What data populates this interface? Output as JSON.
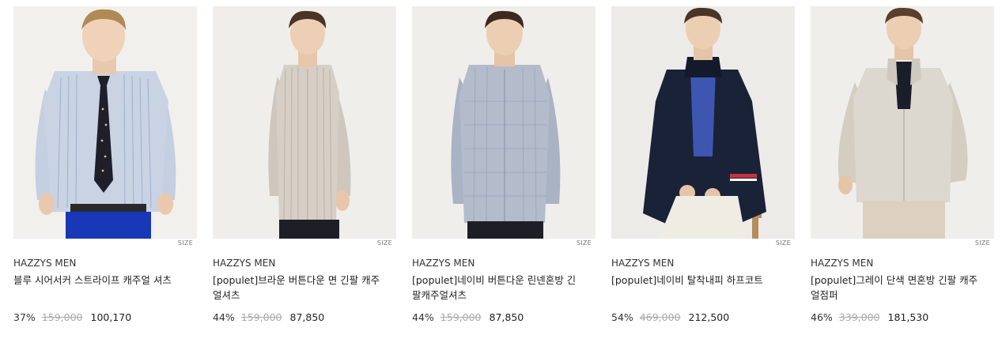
{
  "products": [
    {
      "brand": "HAZZYS MEN",
      "name": "블루 시어서커 스트라이프 캐주얼 셔츠",
      "discount": "37%",
      "original_price": "159,000",
      "sale_price": "100,170",
      "size_label": "SIZE",
      "garment_color": "#c9d3e4",
      "extra_color": "#1838b8"
    },
    {
      "brand": "HAZZYS MEN",
      "name": "[populet]브라운 버튼다운 면 긴팔 캐주얼셔츠",
      "discount": "44%",
      "original_price": "159,000",
      "sale_price": "87,850",
      "size_label": "SIZE",
      "garment_color": "#d6cfc6"
    },
    {
      "brand": "HAZZYS MEN",
      "name": "[populet]네이비 버튼다운 린넨혼방 긴팔캐주얼셔츠",
      "discount": "44%",
      "original_price": "159,000",
      "sale_price": "87,850",
      "size_label": "SIZE",
      "garment_color": "#b4bccb"
    },
    {
      "brand": "HAZZYS MEN",
      "name": "[populet]네이비 탈착내피 하프코트",
      "discount": "54%",
      "original_price": "469,000",
      "sale_price": "212,500",
      "size_label": "SIZE",
      "garment_color": "#1a2238",
      "extra_color": "#3e56b0"
    },
    {
      "brand": "HAZZYS MEN",
      "name": "[populet]그레이 단색 면혼방 긴팔 캐주얼점퍼",
      "discount": "46%",
      "original_price": "339,000",
      "sale_price": "181,530",
      "size_label": "SIZE",
      "garment_color": "#ddd8cf"
    }
  ]
}
